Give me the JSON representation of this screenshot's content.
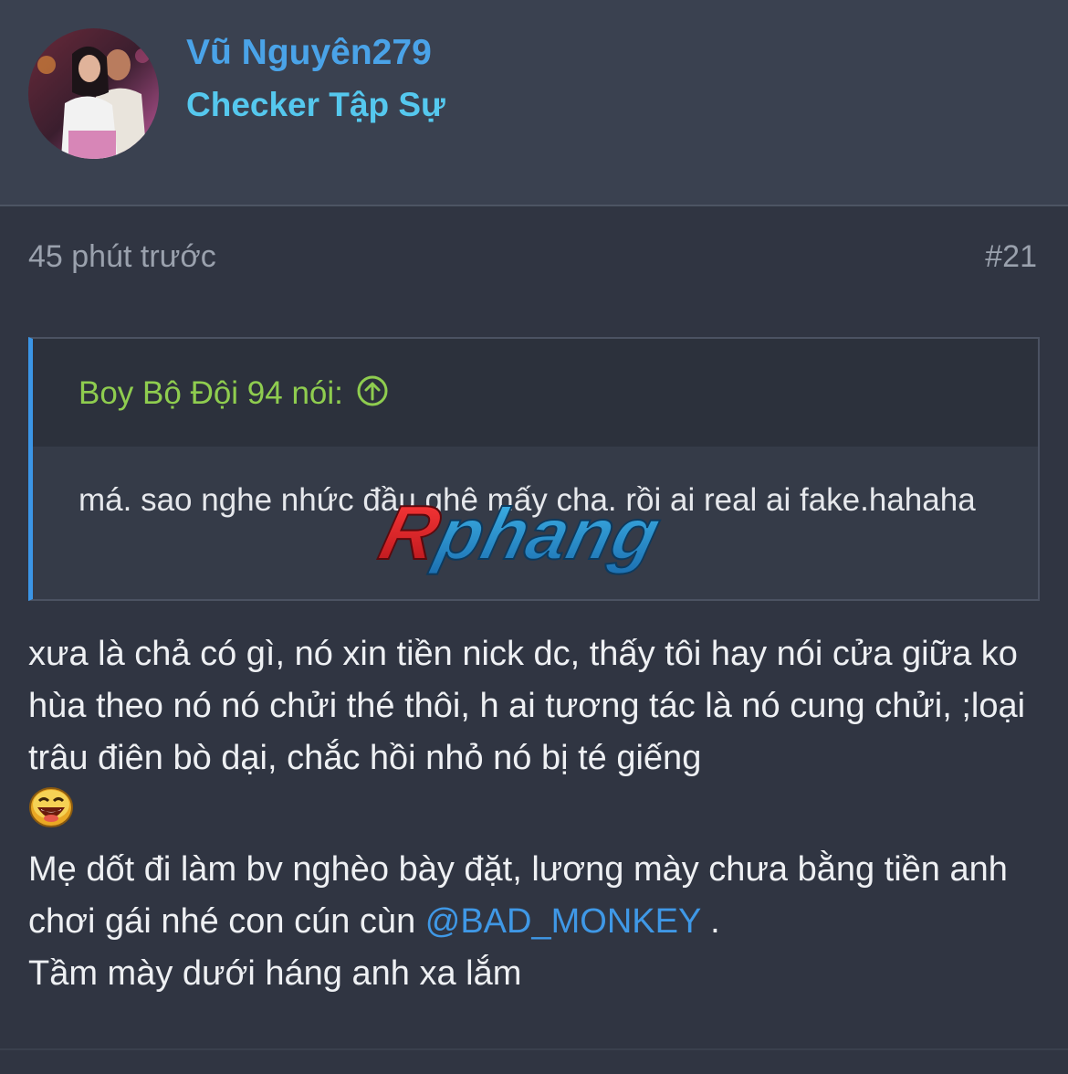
{
  "user": {
    "name": "Vũ Nguyên279",
    "title": "Checker Tập Sự"
  },
  "post": {
    "time": "45 phút trước",
    "number": "#21"
  },
  "quote": {
    "author_label": "Boy Bộ Đội 94 nói:",
    "jump_icon": "arrow-up-circle-icon",
    "text": "má. sao nghe nhức đầu ghê mấy cha. rồi ai real ai fake.hahaha"
  },
  "watermark": {
    "text": "Rphang"
  },
  "body": {
    "line1": "xưa là chả có gì, nó xin tiền nick dc, thấy tôi hay nói cửa giữa ko hùa theo nó nó chửi thé thôi, h ai tương tác là nó cung chửi, ;loại trâu điên bò dại, chắc hồi nhỏ nó bị té giếng",
    "emoji": "laughing-emoji-icon",
    "line2_before": "Mẹ dốt đi làm bv nghèo bày đặt, lương mày chưa bằng tiền anh chơi gái nhé con cún cùn ",
    "mention": "@BAD_MONKEY",
    "line2_after": " .",
    "line3": "Tầm mày dưới háng anh xa lắm"
  },
  "colors": {
    "username": "#4aa3e8",
    "user_title": "#55c8ee",
    "quote_author": "#8fcd4f",
    "quote_border": "#3b95e6",
    "mention": "#3f98e6"
  }
}
